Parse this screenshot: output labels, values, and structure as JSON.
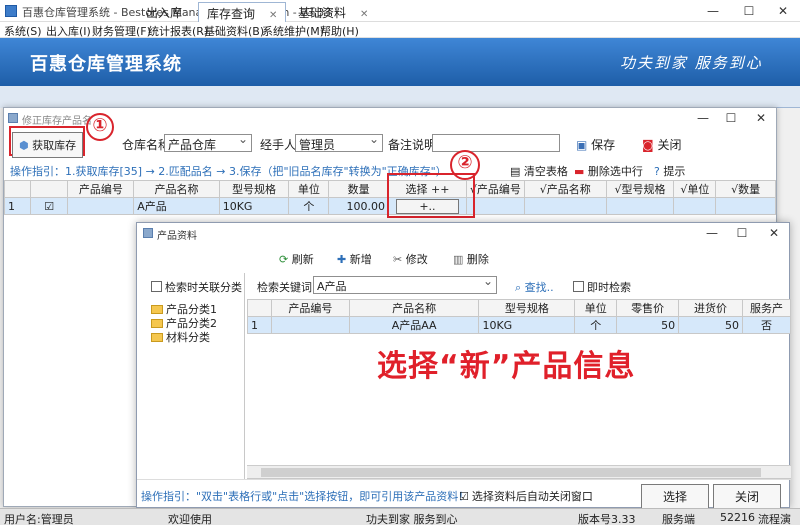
{
  "window": {
    "title": "百惠仓库管理系统 - Bestores Management System - v3.33",
    "min": "—",
    "max": "☐",
    "close": "✕"
  },
  "menu": [
    "系统(S)",
    "出入库(I)",
    "财务管理(F)",
    "统计报表(R)",
    "基础资料(B)",
    "系统维护(M)",
    "帮助(H)"
  ],
  "banner": {
    "brand": "百惠仓库管理系统",
    "slogan": "功夫到家 服务到心"
  },
  "tabs": [
    {
      "label": "出入库"
    },
    {
      "label": "库存查询",
      "active": true,
      "close": "✕"
    },
    {
      "label": "基础资料",
      "close": "✕"
    }
  ],
  "inventory_dialog": {
    "title": "修正库存产品名",
    "buttons": {
      "fetch": "获取库存",
      "save": "保存",
      "close": "关闭",
      "clear": "清空表格",
      "delete_row": "删除选中行",
      "hint": "提示"
    },
    "labels": {
      "warehouse": "仓库名称",
      "handler": "经手人",
      "note": "备注说明"
    },
    "values": {
      "warehouse": "产品仓库",
      "handler": "管理员",
      "note": ""
    },
    "guide": "操作指引：1.获取库存[35] → 2.匹配品名 → 3.保存（把\"旧品名库存\"转换为\"正确库存\"）",
    "columns": [
      "",
      "",
      "产品编号",
      "产品名称",
      "型号规格",
      "单位",
      "数量",
      "选择 ++",
      "√产品编号",
      "√产品名称",
      "√型号规格",
      "√单位",
      "√数量"
    ],
    "rows": [
      {
        "no": "1",
        "checked": "☑",
        "code": "",
        "name": "A产品",
        "spec": "10KG",
        "unit": "个",
        "qty": "100.00",
        "pick": "+..",
        "v_code": "",
        "v_name": "",
        "v_spec": "",
        "v_unit": "",
        "v_qty": ""
      }
    ],
    "markers": {
      "one": "①",
      "two": "②"
    }
  },
  "product_dialog": {
    "title": "产品资料",
    "toolbar": {
      "refresh": "刷新",
      "add": "新增",
      "edit": "修改",
      "delete": "删除"
    },
    "search_linked": "检索时关联分类",
    "search_label": "检索关键词",
    "search_value": "A产品",
    "find": "查找..",
    "instant": "即时检索",
    "tree": [
      "产品分类1",
      "产品分类2",
      "材料分类"
    ],
    "columns": [
      "",
      "产品编号",
      "产品名称",
      "型号规格",
      "单位",
      "零售价",
      "进货价",
      "服务产"
    ],
    "rows": [
      {
        "no": "1",
        "code": "",
        "name": "A产品AA",
        "spec": "10KG",
        "unit": "个",
        "retail": "50",
        "purchase": "50",
        "service": "否"
      }
    ],
    "callout": "选择“新”产品信息",
    "guide": "操作指引：\"双击\"表格行或\"点击\"选择按钮，即可引用该产品资料！",
    "auto_close": "选择资料后自动关闭窗口",
    "select_button": "选择",
    "close_button": "关闭"
  },
  "status": {
    "user": "用户名:管理员",
    "welcome": "欢迎使用",
    "slogan": "功夫到家 服务到心",
    "version": "版本号3.33",
    "side": "服务端",
    "port": "52216",
    "flow": "流程演"
  },
  "colors": {
    "banner": "#2f74c4",
    "accent_red": "#e0202a",
    "guide_blue": "#2d6fb8"
  }
}
